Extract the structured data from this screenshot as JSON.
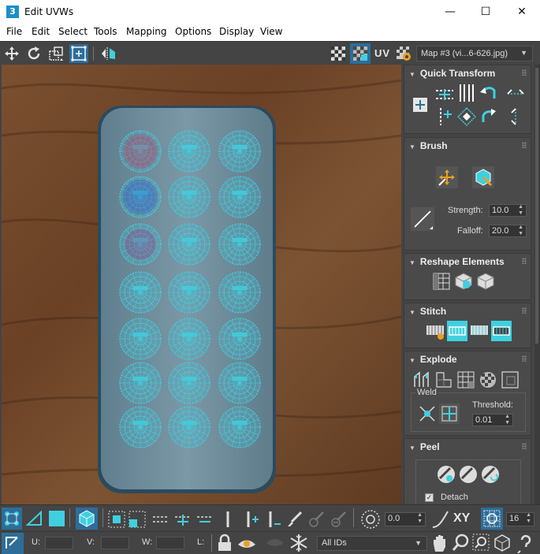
{
  "window": {
    "title": "Edit UVWs",
    "app_icon_label": "3",
    "minimize_glyph": "—",
    "maximize_glyph": "☐",
    "close_glyph": "✕"
  },
  "menu": {
    "items": [
      "File",
      "Edit",
      "Select",
      "Tools",
      "Mapping",
      "Options",
      "Display",
      "View"
    ]
  },
  "toolbar": {
    "uv_label": "UV",
    "map_dropdown": "Map #3 (vi...6-626.jpg)"
  },
  "panel": {
    "quick_transform": {
      "title": "Quick Transform"
    },
    "brush": {
      "title": "Brush",
      "strength_label": "Strength:",
      "strength_value": "10.0",
      "falloff_label": "Falloff:",
      "falloff_value": "20.0"
    },
    "reshape": {
      "title": "Reshape Elements"
    },
    "stitch": {
      "title": "Stitch"
    },
    "explode": {
      "title": "Explode",
      "weld_label": "Weld",
      "threshold_label": "Threshold:",
      "threshold_value": "0.01"
    },
    "peel": {
      "title": "Peel",
      "detach_label": "Detach"
    }
  },
  "bottom": {
    "rotation_value": "0.0",
    "xy_label": "XY",
    "grid_value": "16",
    "u_label": "U:",
    "v_label": "V:",
    "w_label": "W:",
    "l_label": "L:",
    "ids_dropdown": "All IDs"
  },
  "colors": {
    "ui_bg": "#444444",
    "accent_blue": "#2d6d99",
    "uv_cyan": "#3fd0e0",
    "wood": "#6b4228"
  }
}
